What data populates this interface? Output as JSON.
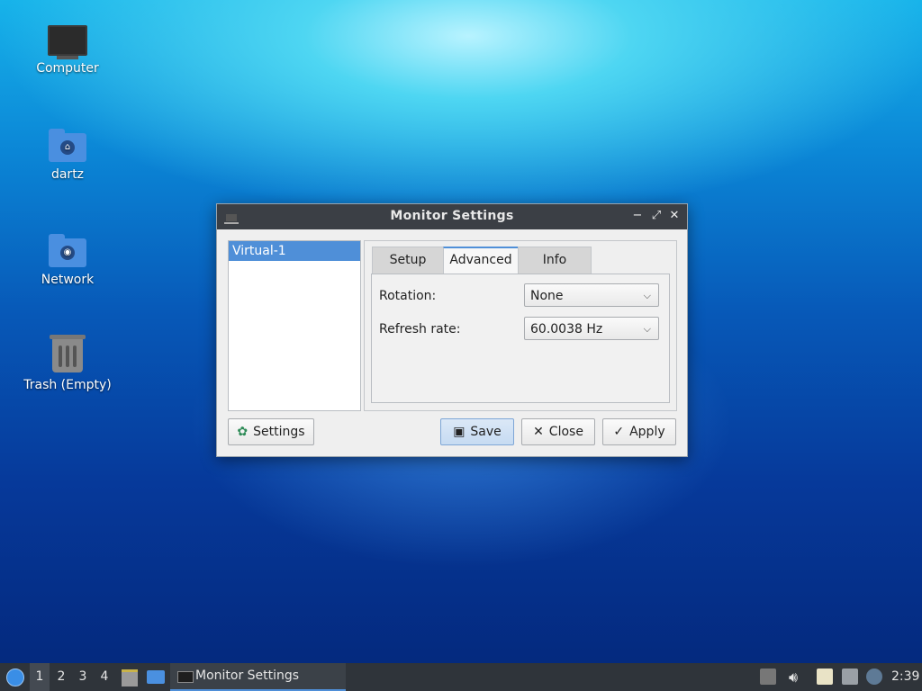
{
  "desktop": {
    "icons": [
      {
        "label": "Computer",
        "icon": "computer-icon"
      },
      {
        "label": "dartz",
        "icon": "home-folder-icon",
        "glyph": "⌂"
      },
      {
        "label": "Network",
        "icon": "network-folder-icon",
        "glyph": "◉"
      },
      {
        "label": "Trash (Empty)",
        "icon": "trash-icon"
      }
    ]
  },
  "window": {
    "title": "Monitor Settings",
    "controls": {
      "minimize": "−",
      "maximize": "⤢",
      "close": "✕"
    },
    "monitors": [
      "Virtual-1"
    ],
    "tabs": [
      "Setup",
      "Advanced",
      "Info"
    ],
    "active_tab": "Advanced",
    "advanced": {
      "rotation_label": "Rotation:",
      "rotation_value": "None",
      "refresh_label": "Refresh rate:",
      "refresh_value": "60.0038 Hz"
    },
    "buttons": {
      "settings": "Settings",
      "save": "Save",
      "close": "Close",
      "apply": "Apply"
    }
  },
  "taskbar": {
    "workspaces": [
      "1",
      "2",
      "3",
      "4"
    ],
    "active_workspace": "1",
    "task": "Monitor Settings",
    "clock": "2:39"
  },
  "colors": {
    "accent": "#4f8fd8",
    "titlebar": "#3b3f45",
    "taskbar": "#2f343a"
  }
}
